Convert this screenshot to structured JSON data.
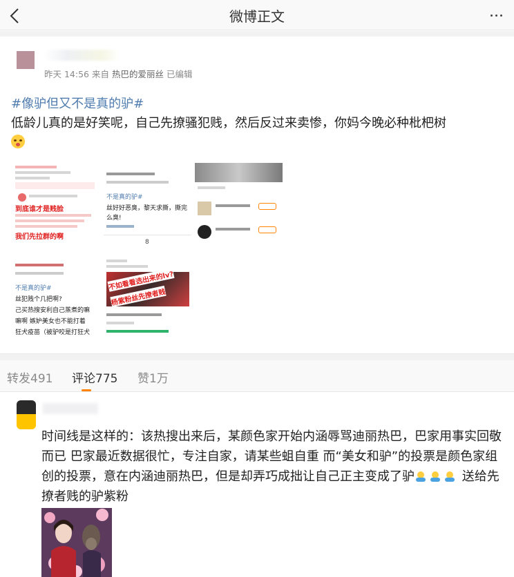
{
  "nav": {
    "title": "微博正文"
  },
  "post": {
    "meta_time": "昨天 14:56",
    "meta_from": "来自",
    "meta_source": "热巴的爱丽丝",
    "meta_edited": "已编辑",
    "hashtag": "#像驴但又不是真的驴#",
    "text": "低龄儿真的是好笑呢，自己先撩骚犯贱，然后反过来卖惨，你妈今晚必种枇杷树"
  },
  "thumbs": {
    "t2_line1": "不是真的驴#",
    "t2_line2": "不是真的驴#",
    "t2_line3": "丝好好恶臭，黎天求撕，撕完",
    "t2_line4": "么臭!",
    "t2_count": "8",
    "t4_line1": "不是真的驴#",
    "t4_line2": "丝犯贱个几把啊?",
    "t4_line3": "己买热搜安利自己蒸煮的嘛",
    "t4_line4": "嘛啊  嫉妒美女也不能打着",
    "t4_line5": "狂犬疫苗（被驴咬是打狂犬",
    "t5_red1": "不如看看选出来的lv?",
    "t5_red2": "杨紫粉丝先撩者贱",
    "t1_red1": "到底谁才是贱脸",
    "t1_red2": "我们先拉群的啊"
  },
  "tabs": {
    "repost": "转发491",
    "comments": "评论775",
    "likes": "赞1万"
  },
  "comment": {
    "text_part1": "时间线是这样的：该热搜出来后，某颜色家开始内涵辱骂迪丽热巴，巴家用事实回敬而已 巴家最近数据很忙，专注自家，请某些蛆自重 而“美女和驴”的投票是颜色家组创的投票，意在内涵迪丽热巴，但是却弄巧成拙让自己正主变成了驴",
    "text_part2": " 送给先撩者贱的驴紫粉"
  },
  "colors": {
    "hashtag": "#507daf",
    "accent": "#ff8200",
    "text": "#222222",
    "meta": "#8a8a8a"
  },
  "icons": [
    "back-chevron-icon",
    "more-dots-icon",
    "scream-emoji-icon",
    "hands-emoji-icon"
  ]
}
